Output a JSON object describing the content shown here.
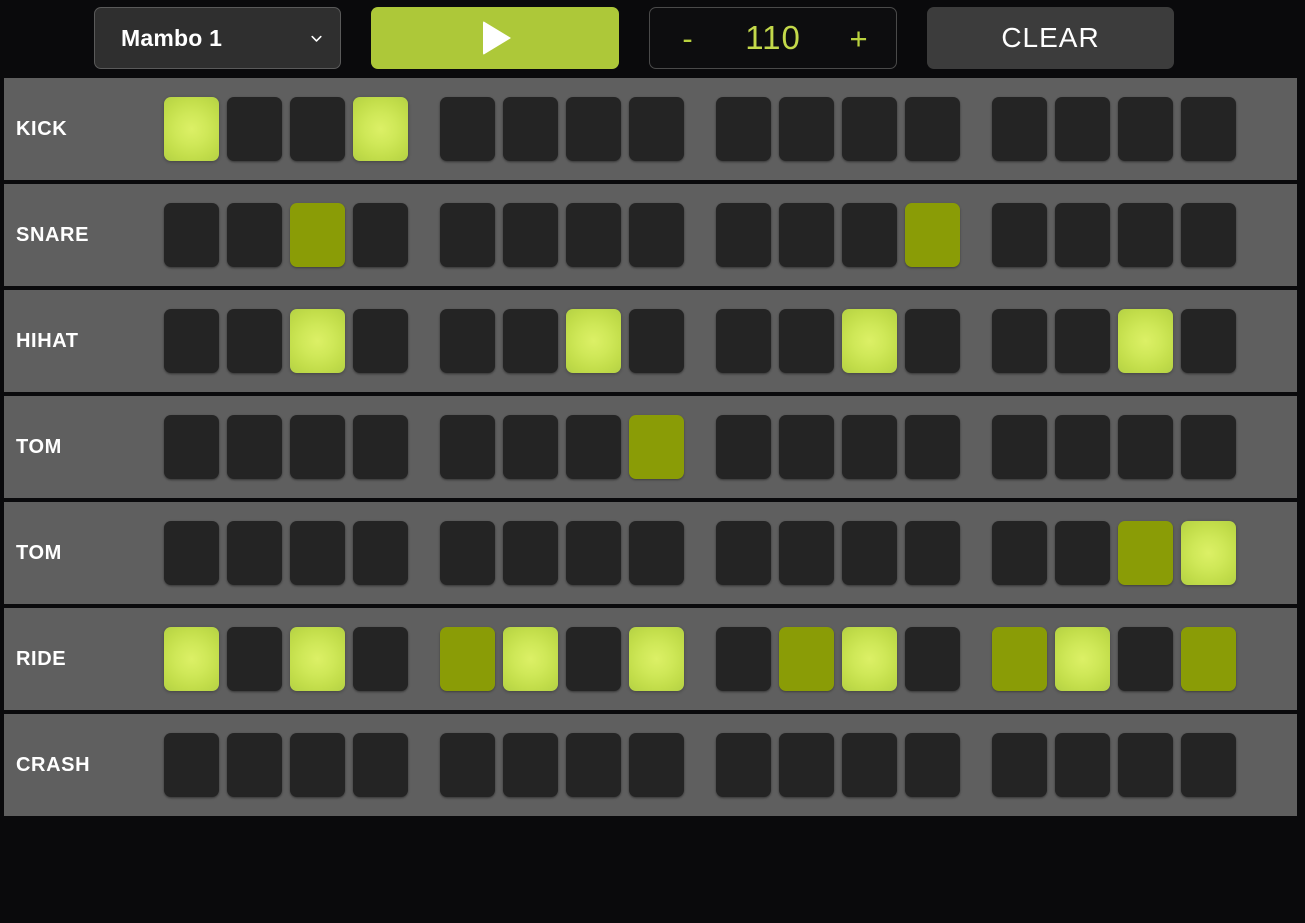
{
  "toolbar": {
    "pattern_select": {
      "value": "Mambo 1",
      "chevron_icon": "chevron-down-icon"
    },
    "play": {
      "icon": "play-triangle-icon",
      "label": ""
    },
    "tempo": {
      "decrement_label": "-",
      "value": "110",
      "increment_label": "+"
    },
    "clear_label": "CLEAR"
  },
  "colors": {
    "background": "#0a0a0c",
    "row_background": "#5f5f5f",
    "step_off": "#242424",
    "step_on_dim": "#8a9c06",
    "step_on_bright": "#cfe858",
    "accent_green": "#adc839",
    "tempo_text": "#c3d84a",
    "text": "#ffffff"
  },
  "sequencer": {
    "step_count": 16,
    "group_size": 4,
    "tracks": [
      {
        "label": "KICK",
        "steps": [
          "bright",
          "off",
          "off",
          "bright",
          "off",
          "off",
          "off",
          "off",
          "off",
          "off",
          "off",
          "off",
          "off",
          "off",
          "off",
          "off"
        ]
      },
      {
        "label": "SNARE",
        "steps": [
          "off",
          "off",
          "dim",
          "off",
          "off",
          "off",
          "off",
          "off",
          "off",
          "off",
          "off",
          "dim",
          "off",
          "off",
          "off",
          "off"
        ]
      },
      {
        "label": "HIHAT",
        "steps": [
          "off",
          "off",
          "bright",
          "off",
          "off",
          "off",
          "bright",
          "off",
          "off",
          "off",
          "bright",
          "off",
          "off",
          "off",
          "bright",
          "off"
        ]
      },
      {
        "label": "TOM",
        "steps": [
          "off",
          "off",
          "off",
          "off",
          "off",
          "off",
          "off",
          "dim",
          "off",
          "off",
          "off",
          "off",
          "off",
          "off",
          "off",
          "off"
        ]
      },
      {
        "label": "TOM",
        "steps": [
          "off",
          "off",
          "off",
          "off",
          "off",
          "off",
          "off",
          "off",
          "off",
          "off",
          "off",
          "off",
          "off",
          "off",
          "dim",
          "bright"
        ]
      },
      {
        "label": "RIDE",
        "steps": [
          "bright",
          "off",
          "bright",
          "off",
          "dim",
          "bright",
          "off",
          "bright",
          "off",
          "dim",
          "bright",
          "off",
          "dim",
          "bright",
          "off",
          "dim"
        ]
      },
      {
        "label": "CRASH",
        "steps": [
          "off",
          "off",
          "off",
          "off",
          "off",
          "off",
          "off",
          "off",
          "off",
          "off",
          "off",
          "off",
          "off",
          "off",
          "off",
          "off"
        ]
      }
    ]
  }
}
